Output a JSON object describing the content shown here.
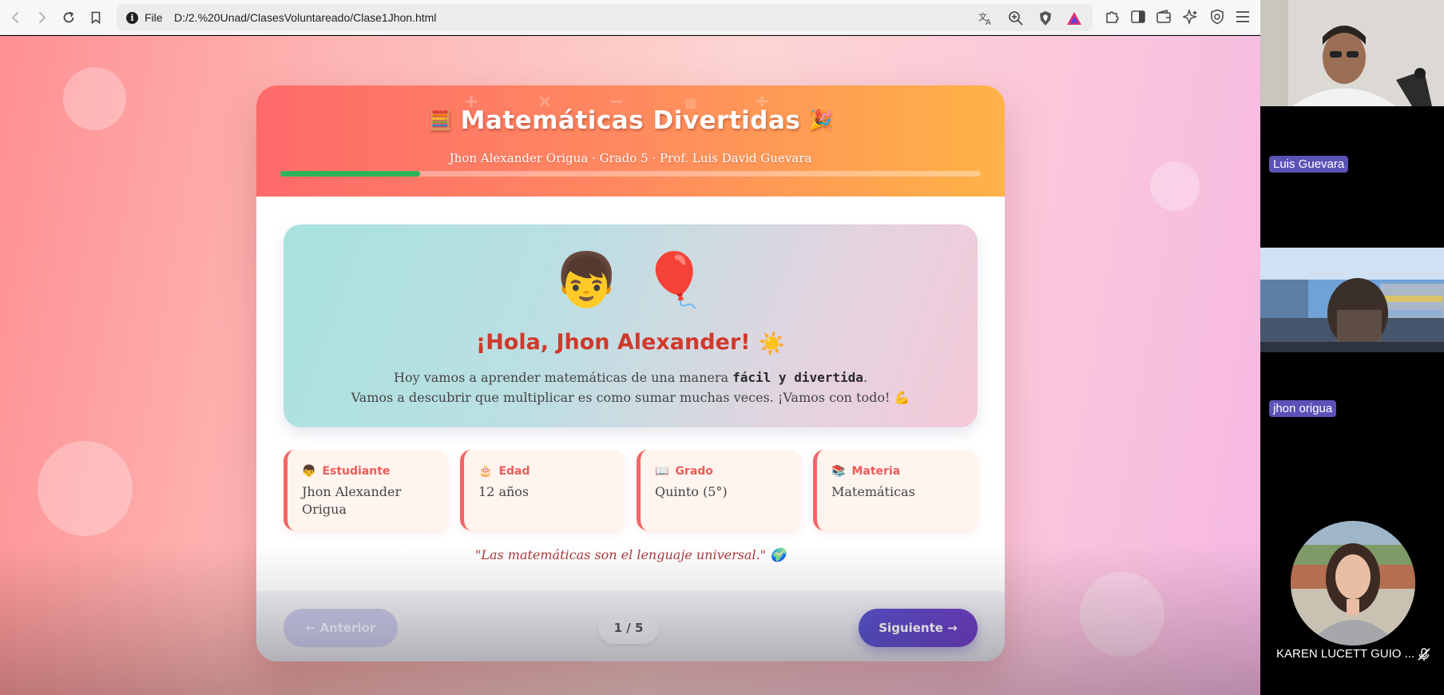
{
  "browser": {
    "site_label": "File",
    "url": "D:/2.%20Unad/ClasesVoluntareado/Clase1Jhon.html"
  },
  "lesson": {
    "symbols": [
      "+",
      "×",
      "−",
      "÷"
    ],
    "title": "Matemáticas Divertidas",
    "title_emoji_left": "🧮",
    "title_emoji_right": "🎉",
    "subtitle": "Jhon Alexander Origua · Grado 5 · Prof. Luis David Guevara",
    "progress_fraction": 0.2,
    "hero": {
      "art_emojis": [
        "👦",
        "🎈"
      ],
      "greeting": "¡Hola, Jhon Alexander!",
      "greeting_emoji": "☀️",
      "line1_before": "Hoy vamos a aprender matemáticas de una manera",
      "line1_bold": "fácil y divertida",
      "line1_after": ".",
      "line2": "Vamos a descubrir que multiplicar es como sumar muchas veces. ¡Vamos con todo!",
      "line2_emoji": "💪"
    },
    "info_cards": [
      {
        "icon": "👦",
        "label": "Estudiante",
        "value": "Jhon Alexander Origua"
      },
      {
        "icon": "🎂",
        "label": "Edad",
        "value": "12 años"
      },
      {
        "icon": "📖",
        "label": "Grado",
        "value": "Quinto (5°)"
      },
      {
        "icon": "📚",
        "label": "Materia",
        "value": "Matemáticas"
      }
    ],
    "quote": "\"Las matemáticas son el lenguaje universal.\"",
    "quote_emoji": "🌍",
    "nav": {
      "prev_label": "← Anterior",
      "page_counter": "1 / 5",
      "next_label": "Siguiente →"
    }
  },
  "call": {
    "participants": [
      {
        "name": "Luis Guevara"
      },
      {
        "name": "jhon origua"
      },
      {
        "name": "KAREN LUCETT GUIO ..."
      }
    ]
  },
  "colors": {
    "header_start": "#ff6a6a",
    "header_end": "#ffb347",
    "accent_red": "#ef5a5a",
    "next_button": "#5a54cf",
    "progress": "#2eb35a",
    "name_tag": "#5b52b8"
  }
}
